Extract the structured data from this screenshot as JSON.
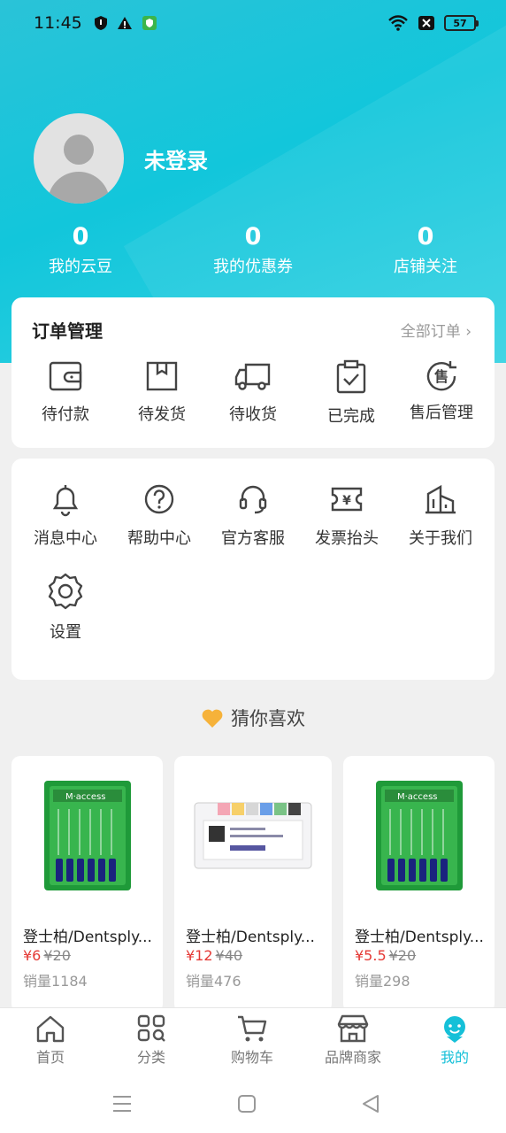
{
  "status_bar": {
    "time": "11:45",
    "battery": "57"
  },
  "profile": {
    "username": "未登录"
  },
  "stats": [
    {
      "value": "0",
      "label": "我的云豆"
    },
    {
      "value": "0",
      "label": "我的优惠券"
    },
    {
      "value": "0",
      "label": "店铺关注"
    }
  ],
  "orders": {
    "title": "订单管理",
    "all_link": "全部订单",
    "items": [
      {
        "label": "待付款",
        "icon": "wallet-icon"
      },
      {
        "label": "待发货",
        "icon": "box-icon"
      },
      {
        "label": "待收货",
        "icon": "truck-icon"
      },
      {
        "label": "已完成",
        "icon": "clipboard-check-icon"
      },
      {
        "label": "售后管理",
        "icon": "after-sale-icon"
      }
    ]
  },
  "tools": {
    "items": [
      {
        "label": "消息中心",
        "icon": "bell-icon"
      },
      {
        "label": "帮助中心",
        "icon": "help-icon"
      },
      {
        "label": "官方客服",
        "icon": "headset-icon"
      },
      {
        "label": "发票抬头",
        "icon": "invoice-icon"
      },
      {
        "label": "关于我们",
        "icon": "building-icon"
      },
      {
        "label": "设置",
        "icon": "gear-icon"
      }
    ]
  },
  "recommend": {
    "title": "猜你喜欢"
  },
  "products": [
    {
      "name": "登士柏/Dentsply...",
      "price": "¥6",
      "old_price": "¥20",
      "sales": "销量1184"
    },
    {
      "name": "登士柏/Dentsply...",
      "price": "¥12",
      "old_price": "¥40",
      "sales": "销量476"
    },
    {
      "name": "登士柏/Dentsply...",
      "price": "¥5.5",
      "old_price": "¥20",
      "sales": "销量298"
    }
  ],
  "tabbar": [
    {
      "label": "首页",
      "icon": "home-icon"
    },
    {
      "label": "分类",
      "icon": "category-icon"
    },
    {
      "label": "购物车",
      "icon": "cart-icon"
    },
    {
      "label": "品牌商家",
      "icon": "store-icon"
    },
    {
      "label": "我的",
      "icon": "profile-icon",
      "active": true
    }
  ],
  "colors": {
    "accent": "#15c0d8",
    "price": "#e53935"
  }
}
